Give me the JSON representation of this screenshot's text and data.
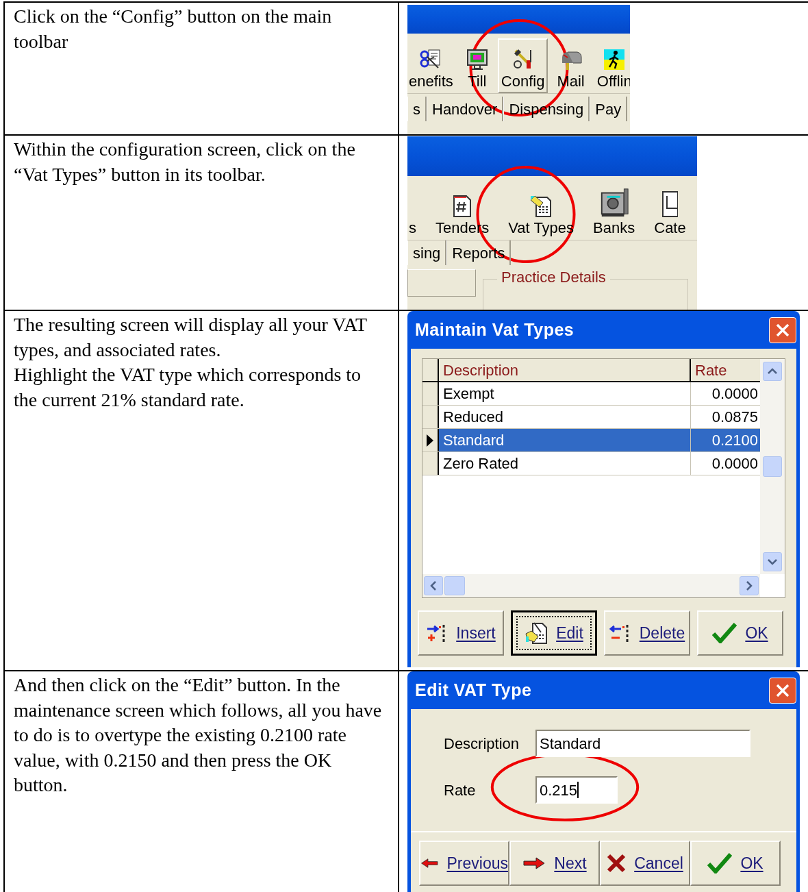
{
  "steps": [
    {
      "kind": "toolbar",
      "instruction": [
        "Click on the “Config” button on the main toolbar"
      ],
      "toolbar": [
        {
          "label": "enefits",
          "selected": false,
          "circled": false
        },
        {
          "label": "Till",
          "selected": false,
          "circled": false
        },
        {
          "label": "Config",
          "selected": true,
          "circled": true
        },
        {
          "label": "Mail",
          "selected": false,
          "circled": false
        },
        {
          "label": "Offlin",
          "selected": false,
          "circled": false
        }
      ],
      "tabs": [
        "s",
        "Handover",
        "Dispensing",
        "Pay"
      ]
    },
    {
      "kind": "toolbar",
      "instruction": [
        "Within the configuration screen, click on the “Vat Types” button in its toolbar."
      ],
      "toolbar": [
        {
          "label": "s",
          "selected": false,
          "circled": false
        },
        {
          "label": "Tenders",
          "selected": false,
          "circled": false
        },
        {
          "label": "Vat Types",
          "selected": false,
          "circled": true
        },
        {
          "label": "Banks",
          "selected": false,
          "circled": false
        },
        {
          "label": "Cate",
          "selected": false,
          "circled": false
        }
      ],
      "tabs": [
        "sing",
        "Reports"
      ],
      "group": {
        "title": "Practice Details"
      }
    },
    {
      "kind": "grid_dialog",
      "instruction": [
        "The resulting screen will display all your VAT types, and associated rates.",
        "Highlight the VAT type which corresponds to the current 21% standard rate."
      ],
      "dialog": {
        "title": "Maintain Vat Types",
        "columns": [
          "Description",
          "Rate"
        ],
        "rows": [
          {
            "description": "Exempt",
            "rate": "0.0000",
            "selected": false
          },
          {
            "description": "Reduced",
            "rate": "0.0875",
            "selected": false
          },
          {
            "description": "Standard",
            "rate": "0.2100",
            "selected": true
          },
          {
            "description": "Zero Rated",
            "rate": "0.0000",
            "selected": false
          }
        ],
        "buttons": [
          {
            "label": "Insert",
            "focused": false
          },
          {
            "label": "Edit",
            "focused": true
          },
          {
            "label": "Delete",
            "focused": false
          },
          {
            "label": "OK",
            "focused": false
          }
        ]
      }
    },
    {
      "kind": "edit_dialog",
      "instruction": [
        "And then click on the “Edit” button. In the maintenance screen which follows, all you have to do is to overtype the existing 0.2100 rate value, with 0.2150 and then press the OK button."
      ],
      "dialog": {
        "title": "Edit VAT Type",
        "fields": [
          {
            "label": "Description",
            "value": "Standard",
            "focused": false,
            "circled": false
          },
          {
            "label": "Rate",
            "value": "0.215",
            "focused": true,
            "circled": true
          }
        ],
        "buttons": [
          {
            "label": "Previous",
            "focused": false
          },
          {
            "label": "Next",
            "focused": false
          },
          {
            "label": "Cancel",
            "focused": false
          },
          {
            "label": "OK",
            "focused": false
          }
        ]
      }
    }
  ]
}
